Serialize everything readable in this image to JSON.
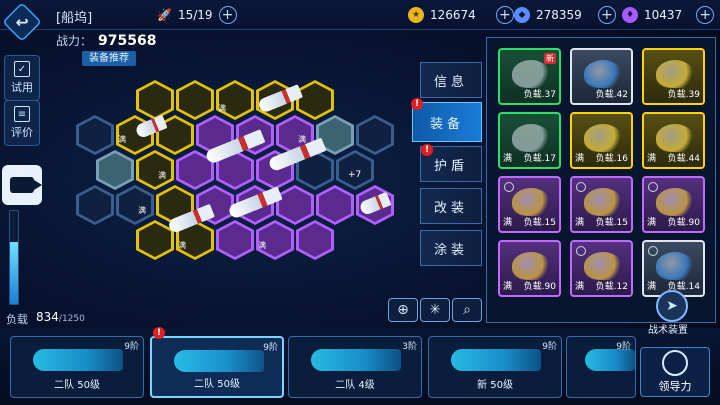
{
  "header": {
    "title": "[船坞]",
    "fleet_count": "15/19",
    "resources": [
      {
        "icon": "gold-coin-icon",
        "value": "126674",
        "color": "#e8b620"
      },
      {
        "icon": "crystal-icon",
        "value": "278359",
        "color": "#5a8dff"
      },
      {
        "icon": "gem-icon",
        "value": "10437",
        "color": "#a45cff"
      }
    ]
  },
  "left": {
    "trial_label": "试用",
    "review_label": "评价",
    "load_label": "负载",
    "load_current": "834",
    "load_max": "/1250",
    "load_fraction": 0.667
  },
  "ship": {
    "power_label": "战力：",
    "power_value": "975568",
    "recommend_label": "装备推荐",
    "slot_full": "满",
    "plus_level": "+7"
  },
  "menu": [
    {
      "label": "信息",
      "active": false,
      "alert": false
    },
    {
      "label": "装备",
      "active": true,
      "alert": true
    },
    {
      "label": "护盾",
      "active": false,
      "alert": true
    },
    {
      "label": "改装",
      "active": false,
      "alert": false
    },
    {
      "label": "涂装",
      "active": false,
      "alert": false
    }
  ],
  "alert_mark": "!",
  "equipment": [
    {
      "full": "",
      "load": "负载.37",
      "rarity": "green",
      "new": "新"
    },
    {
      "full": "",
      "load": "负载.42",
      "rarity": "white",
      "new": ""
    },
    {
      "full": "",
      "load": "负载.39",
      "rarity": "yellow",
      "new": ""
    },
    {
      "full": "满",
      "load": "负载.17",
      "rarity": "green",
      "new": ""
    },
    {
      "full": "满",
      "load": "负载.16",
      "rarity": "yellow",
      "new": ""
    },
    {
      "full": "满",
      "load": "负载.44",
      "rarity": "yellow",
      "new": ""
    },
    {
      "full": "满",
      "load": "负载.15",
      "rarity": "purple",
      "new": ""
    },
    {
      "full": "满",
      "load": "负载.15",
      "rarity": "purple",
      "new": ""
    },
    {
      "full": "满",
      "load": "负载.90",
      "rarity": "purple",
      "new": ""
    },
    {
      "full": "满",
      "load": "负载.90",
      "rarity": "purple",
      "new": ""
    },
    {
      "full": "满",
      "load": "负载.12",
      "rarity": "purple",
      "new": ""
    },
    {
      "full": "满",
      "load": "负载.14",
      "rarity": "white",
      "new": ""
    }
  ],
  "tactic_label": "战术装置",
  "fleet": [
    {
      "name": "二队 50级",
      "tier": "9阶",
      "selected": false,
      "alert": false
    },
    {
      "name": "二队 50级",
      "tier": "9阶",
      "selected": true,
      "alert": true
    },
    {
      "name": "二队 4级",
      "tier": "3阶",
      "selected": false,
      "alert": false
    },
    {
      "name": "新 50级",
      "tier": "9阶",
      "selected": false,
      "alert": false
    },
    {
      "name": "",
      "tier": "9阶",
      "selected": false,
      "alert": false
    }
  ],
  "leadership_label": "领导力"
}
